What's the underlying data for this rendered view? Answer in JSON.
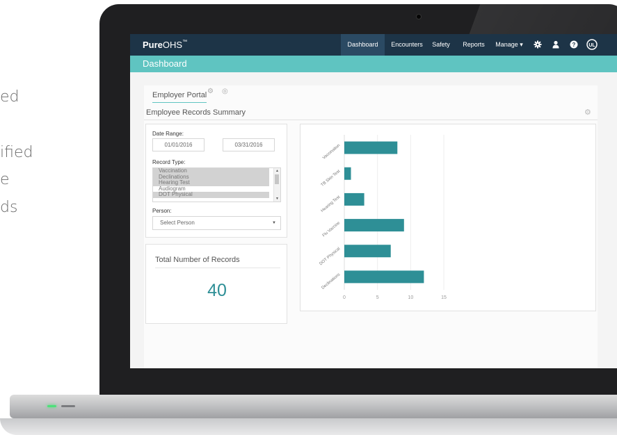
{
  "side_text": [
    "ed",
    "ified",
    "e",
    "ds"
  ],
  "app": {
    "brand_bold": "Pure",
    "brand_light": "OHS",
    "brand_tm": "™"
  },
  "nav": {
    "items": [
      {
        "label": "Dashboard",
        "active": true
      },
      {
        "label": "Encounters",
        "active": false
      },
      {
        "label": "Safety",
        "active": false
      },
      {
        "label": "Reports",
        "active": false
      },
      {
        "label": "Manage ▾",
        "active": false
      }
    ],
    "icons": [
      "gear-icon",
      "user-icon",
      "help-icon",
      "ul-badge-icon"
    ]
  },
  "page_title": "Dashboard",
  "portal": {
    "tab_label": "Employer Portal",
    "section_title": "Employee Records Summary"
  },
  "filters": {
    "date_range_label": "Date Range:",
    "date_from": "01/01/2016",
    "date_to": "03/31/2016",
    "record_type_label": "Record Type:",
    "record_types": [
      {
        "label": "Vaccination",
        "selected": true
      },
      {
        "label": "Declinations",
        "selected": true
      },
      {
        "label": "Hearing Test",
        "selected": true
      },
      {
        "label": "Audiogram",
        "selected": false
      },
      {
        "label": "DOT Physical",
        "selected": true
      }
    ],
    "person_label": "Person:",
    "person_placeholder": "Select Person"
  },
  "total": {
    "title": "Total Number of Records",
    "value": "40"
  },
  "colors": {
    "navbar": "#1d3447",
    "accent": "#5fc4c1",
    "bar": "#2e8f96"
  },
  "chart_data": {
    "type": "bar",
    "orientation": "horizontal",
    "categories": [
      "Vaccination",
      "TB Skin Test",
      "Hearing Test",
      "Flu Vaccine",
      "DOT Physical",
      "Declinations"
    ],
    "values": [
      8,
      1,
      3,
      9,
      7,
      12
    ],
    "xticks": [
      0,
      5,
      10,
      15
    ],
    "xlim": [
      0,
      15
    ],
    "grid": true
  }
}
